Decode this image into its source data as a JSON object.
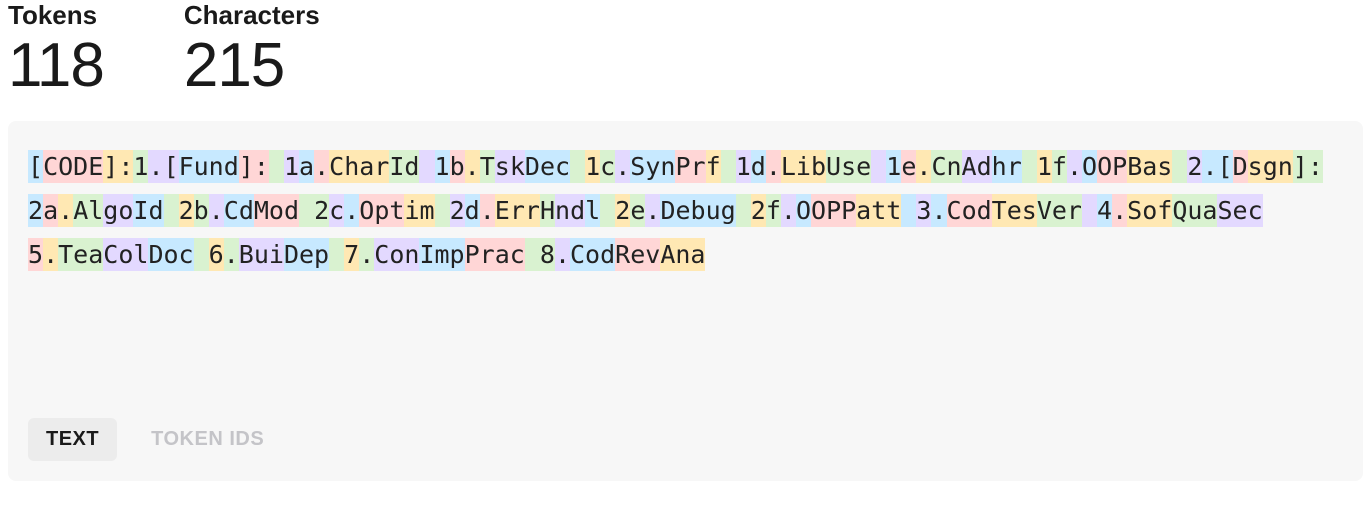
{
  "stats": {
    "tokens_label": "Tokens",
    "tokens_value": "118",
    "chars_label": "Characters",
    "chars_value": "215"
  },
  "tokens": [
    {
      "t": "[",
      "c": 0
    },
    {
      "t": "CODE",
      "c": 1
    },
    {
      "t": "]:",
      "c": 2
    },
    {
      "t": "1",
      "c": 3
    },
    {
      "t": ".[",
      "c": 4
    },
    {
      "t": "Fund",
      "c": 0
    },
    {
      "t": "]:",
      "c": 1
    },
    {
      "t": " ",
      "c": 3
    },
    {
      "t": "1",
      "c": 4
    },
    {
      "t": "a",
      "c": 0
    },
    {
      "t": ".",
      "c": 1
    },
    {
      "t": "Char",
      "c": 2
    },
    {
      "t": "Id",
      "c": 3
    },
    {
      "t": " ",
      "c": 4
    },
    {
      "t": "1",
      "c": 0
    },
    {
      "t": "b",
      "c": 1
    },
    {
      "t": ".",
      "c": 2
    },
    {
      "t": "T",
      "c": 3
    },
    {
      "t": "sk",
      "c": 4
    },
    {
      "t": "Dec",
      "c": 0
    },
    {
      "t": " ",
      "c": 3
    },
    {
      "t": "1",
      "c": 2
    },
    {
      "t": "c",
      "c": 3
    },
    {
      "t": ".",
      "c": 4
    },
    {
      "t": "Syn",
      "c": 0
    },
    {
      "t": "Pr",
      "c": 1
    },
    {
      "t": "f",
      "c": 2
    },
    {
      "t": " ",
      "c": 3
    },
    {
      "t": "1",
      "c": 4
    },
    {
      "t": "d",
      "c": 0
    },
    {
      "t": ".",
      "c": 1
    },
    {
      "t": "Lib",
      "c": 2
    },
    {
      "t": "Use",
      "c": 3
    },
    {
      "t": " ",
      "c": 4
    },
    {
      "t": "1",
      "c": 0
    },
    {
      "t": "e",
      "c": 1
    },
    {
      "t": ".",
      "c": 2
    },
    {
      "t": "Cn",
      "c": 3
    },
    {
      "t": "Ad",
      "c": 4
    },
    {
      "t": "hr",
      "c": 0
    },
    {
      "t": " ",
      "c": 3
    },
    {
      "t": "1",
      "c": 2
    },
    {
      "t": "f",
      "c": 3
    },
    {
      "t": ".",
      "c": 4
    },
    {
      "t": "O",
      "c": 0
    },
    {
      "t": "OP",
      "c": 1
    },
    {
      "t": "Bas",
      "c": 2
    },
    {
      "t": " ",
      "c": 3
    },
    {
      "t": "2",
      "c": 4
    },
    {
      "t": ".[",
      "c": 0
    },
    {
      "t": "D",
      "c": 1
    },
    {
      "t": "sgn",
      "c": 2
    },
    {
      "t": "]:",
      "c": 3
    },
    {
      "t": " ",
      "c": 4
    },
    {
      "t": "2",
      "c": 0
    },
    {
      "t": "a",
      "c": 1
    },
    {
      "t": ".",
      "c": 2
    },
    {
      "t": "Al",
      "c": 3
    },
    {
      "t": "go",
      "c": 4
    },
    {
      "t": "Id",
      "c": 0
    },
    {
      "t": " ",
      "c": 3
    },
    {
      "t": "2",
      "c": 2
    },
    {
      "t": "b",
      "c": 3
    },
    {
      "t": ".",
      "c": 4
    },
    {
      "t": "Cd",
      "c": 0
    },
    {
      "t": "Mod",
      "c": 1
    },
    {
      "t": " ",
      "c": 3
    },
    {
      "t": "2",
      "c": 3
    },
    {
      "t": "c",
      "c": 4
    },
    {
      "t": ".",
      "c": 0
    },
    {
      "t": "Opt",
      "c": 1
    },
    {
      "t": "im",
      "c": 2
    },
    {
      "t": " ",
      "c": 3
    },
    {
      "t": "2",
      "c": 4
    },
    {
      "t": "d",
      "c": 0
    },
    {
      "t": ".",
      "c": 1
    },
    {
      "t": "Err",
      "c": 2
    },
    {
      "t": "H",
      "c": 3
    },
    {
      "t": "nd",
      "c": 4
    },
    {
      "t": "l",
      "c": 0
    },
    {
      "t": " ",
      "c": 3
    },
    {
      "t": "2",
      "c": 2
    },
    {
      "t": "e",
      "c": 3
    },
    {
      "t": ".",
      "c": 4
    },
    {
      "t": "Debug",
      "c": 0
    },
    {
      "t": " ",
      "c": 3
    },
    {
      "t": "2",
      "c": 2
    },
    {
      "t": "f",
      "c": 3
    },
    {
      "t": ".",
      "c": 4
    },
    {
      "t": "O",
      "c": 0
    },
    {
      "t": "OPP",
      "c": 1
    },
    {
      "t": "att",
      "c": 2
    },
    {
      "t": " ",
      "c": 0
    },
    {
      "t": "3",
      "c": 4
    },
    {
      "t": ".",
      "c": 0
    },
    {
      "t": "Cod",
      "c": 1
    },
    {
      "t": "Tes",
      "c": 2
    },
    {
      "t": "Ver",
      "c": 3
    },
    {
      "t": " ",
      "c": 4
    },
    {
      "t": "4",
      "c": 0
    },
    {
      "t": ".",
      "c": 1
    },
    {
      "t": "Sof",
      "c": 2
    },
    {
      "t": "Qua",
      "c": 3
    },
    {
      "t": "Sec",
      "c": 4
    },
    {
      "t": " ",
      "c": 3
    },
    {
      "t": "5",
      "c": 1
    },
    {
      "t": ".",
      "c": 2
    },
    {
      "t": "Tea",
      "c": 3
    },
    {
      "t": "Col",
      "c": 4
    },
    {
      "t": "Doc",
      "c": 0
    },
    {
      "t": " ",
      "c": 3
    },
    {
      "t": "6",
      "c": 2
    },
    {
      "t": ".",
      "c": 3
    },
    {
      "t": "Bui",
      "c": 4
    },
    {
      "t": "Dep",
      "c": 0
    },
    {
      "t": " ",
      "c": 3
    },
    {
      "t": "7",
      "c": 2
    },
    {
      "t": ".",
      "c": 3
    },
    {
      "t": "Con",
      "c": 4
    },
    {
      "t": "Imp",
      "c": 0
    },
    {
      "t": "Prac",
      "c": 1
    },
    {
      "t": " ",
      "c": 3
    },
    {
      "t": "8",
      "c": 3
    },
    {
      "t": ".",
      "c": 4
    },
    {
      "t": "Cod",
      "c": 0
    },
    {
      "t": "Rev",
      "c": 1
    },
    {
      "t": "Ana",
      "c": 2
    }
  ],
  "tabs": {
    "text": "TEXT",
    "token_ids": "TOKEN IDS",
    "active": "text"
  }
}
